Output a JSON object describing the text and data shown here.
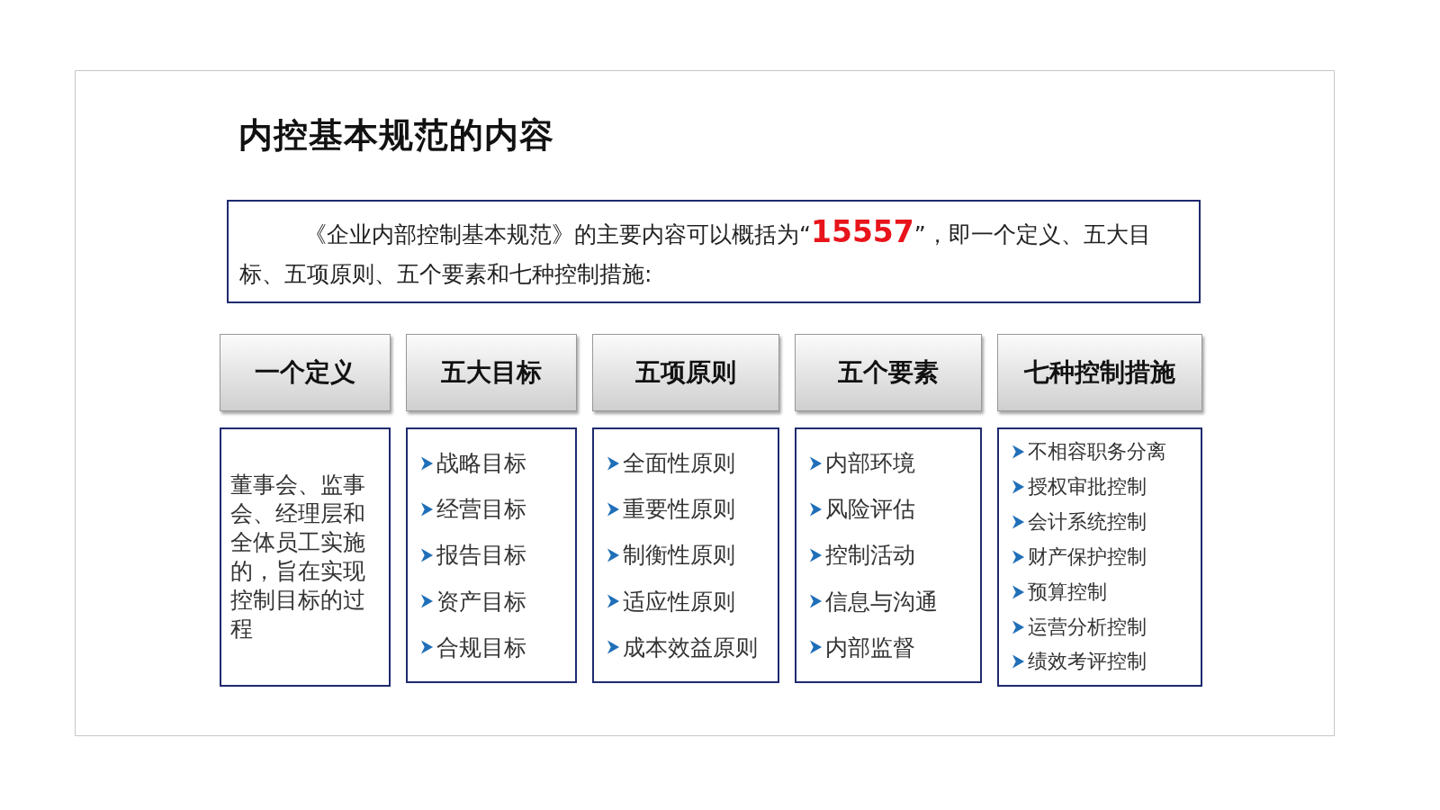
{
  "title": "内控基本规范的内容",
  "summary": {
    "before": "《企业内部控制基本规范》的主要内容可以概括为“",
    "highlight": "15557",
    "after": "”，即一个定义、五大目标、五项原则、五个要素和七种控制措施:"
  },
  "categories": [
    {
      "heading": "一个定义",
      "kind": "paragraph",
      "text": "董事会、监事会、经理层和全体员工实施的，旨在实现控制目标的过程"
    },
    {
      "heading": "五大目标",
      "kind": "list",
      "items": [
        "战略目标",
        "经营目标",
        "报告目标",
        "资产目标",
        "合规目标"
      ]
    },
    {
      "heading": "五项原则",
      "kind": "list",
      "items": [
        "全面性原则",
        "重要性原则",
        "制衡性原则",
        "适应性原则",
        "成本效益原则"
      ]
    },
    {
      "heading": "五个要素",
      "kind": "list",
      "items": [
        "内部环境",
        "风险评估",
        "控制活动",
        "信息与沟通",
        "内部监督"
      ]
    },
    {
      "heading": "七种控制措施",
      "kind": "list",
      "items": [
        "不相容职务分离",
        "授权审批控制",
        "会计系统控制",
        "财产保护控制",
        "预算控制",
        "运营分析控制",
        "绩效考评控制"
      ]
    }
  ]
}
